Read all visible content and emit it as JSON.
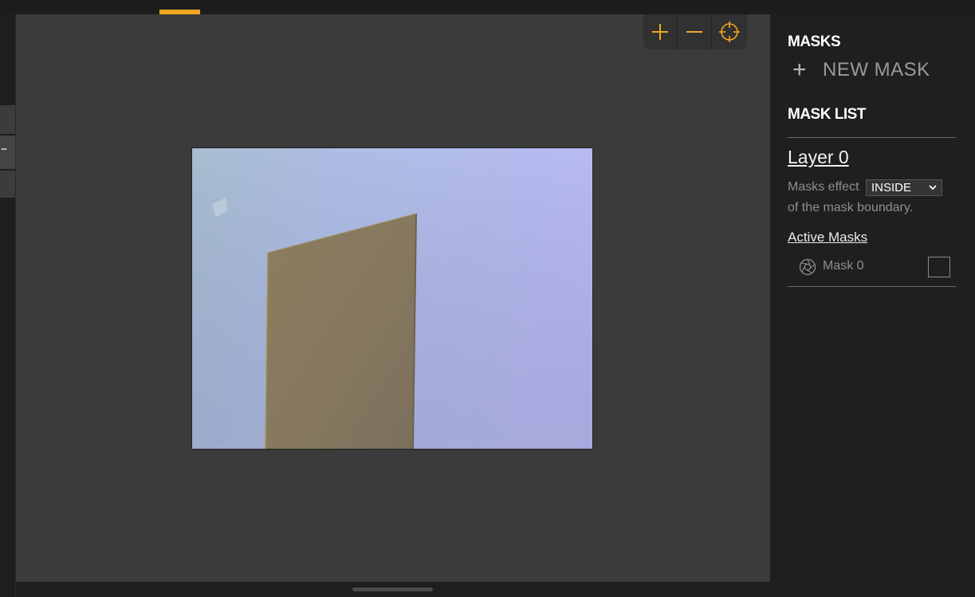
{
  "left_panel": {
    "tab_label": "..."
  },
  "toolbar": {
    "zoom_in_icon": "plus-icon",
    "zoom_out_icon": "minus-icon",
    "recenter_icon": "crosshair-icon",
    "accent_color": "#f0a623"
  },
  "masks_panel": {
    "heading": "MASKS",
    "new_mask_symbol": "+",
    "new_mask_label": "NEW MASK",
    "list_heading": "MASK LIST",
    "layer_title": "Layer 0",
    "effect_prefix": "Masks effect",
    "effect_value": "INSIDE",
    "effect_suffix": "of the mask boundary.",
    "active_masks_label": "Active Masks",
    "masks": [
      {
        "name": "Mask 0",
        "icon": "aperture-icon",
        "checked": false
      }
    ]
  }
}
